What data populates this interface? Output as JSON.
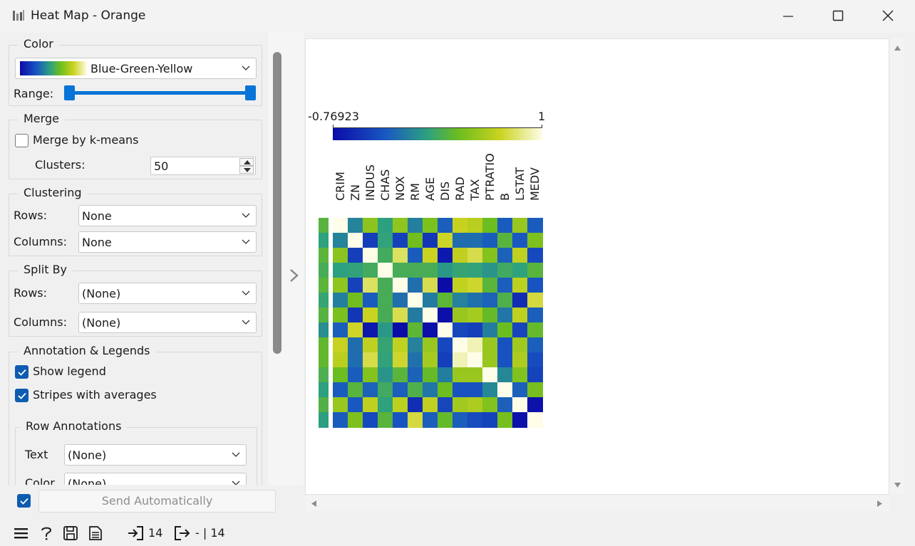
{
  "window": {
    "title": "Heat Map - Orange"
  },
  "color": {
    "group_title": "Color",
    "palette_name": "Blue-Green-Yellow",
    "range_label": "Range:"
  },
  "merge": {
    "group_title": "Merge",
    "merge_kmeans_label": "Merge by k-means",
    "merge_kmeans_checked": false,
    "clusters_label": "Clusters:",
    "clusters_value": "50"
  },
  "clustering": {
    "group_title": "Clustering",
    "rows_label": "Rows:",
    "rows_value": "None",
    "columns_label": "Columns:",
    "columns_value": "None"
  },
  "split_by": {
    "group_title": "Split By",
    "rows_label": "Rows:",
    "rows_value": "(None)",
    "columns_label": "Columns:",
    "columns_value": "(None)"
  },
  "annotation": {
    "group_title": "Annotation & Legends",
    "show_legend_label": "Show legend",
    "show_legend_checked": true,
    "stripes_label": "Stripes with averages",
    "stripes_checked": true,
    "row_annotations": {
      "group_title": "Row Annotations",
      "text_label": "Text",
      "text_value": "(None)",
      "color_label": "Color",
      "color_value": "(None)"
    }
  },
  "send": {
    "auto_checked": true,
    "label": "Send Automatically"
  },
  "status": {
    "input_count": "14",
    "output_text": "- | 14"
  },
  "heatmap": {
    "legend_min": "-0.76923",
    "legend_max": "1",
    "columns": [
      "CRIM",
      "ZN",
      "INDUS",
      "CHAS",
      "NOX",
      "RM",
      "AGE",
      "DIS",
      "RAD",
      "TAX",
      "PTRATIO",
      "B",
      "LSTAT",
      "MEDV"
    ],
    "palette": [
      "#0b0ba8",
      "#1957c2",
      "#2da080",
      "#6cbd1e",
      "#cbd320",
      "#fefde8"
    ],
    "colormap_min": -0.76923,
    "colormap_max": 1,
    "matrix": [
      [
        1.0,
        -0.2,
        0.41,
        -0.06,
        0.42,
        -0.22,
        0.35,
        -0.38,
        0.63,
        0.58,
        0.29,
        -0.39,
        0.46,
        -0.39
      ],
      [
        -0.2,
        1.0,
        -0.53,
        -0.04,
        -0.52,
        0.31,
        -0.57,
        0.66,
        -0.31,
        -0.31,
        -0.39,
        0.18,
        -0.41,
        0.36
      ],
      [
        0.41,
        -0.53,
        1.0,
        0.06,
        0.76,
        -0.39,
        0.64,
        -0.71,
        0.6,
        0.72,
        0.38,
        -0.36,
        0.6,
        -0.48
      ],
      [
        -0.06,
        -0.04,
        0.06,
        1.0,
        0.09,
        0.09,
        0.09,
        -0.1,
        -0.01,
        -0.04,
        -0.12,
        0.05,
        -0.05,
        0.18
      ],
      [
        0.42,
        -0.52,
        0.76,
        0.09,
        1.0,
        -0.3,
        0.73,
        -0.77,
        0.61,
        0.67,
        0.19,
        -0.38,
        0.59,
        -0.43
      ],
      [
        -0.22,
        0.31,
        -0.39,
        0.09,
        -0.3,
        1.0,
        -0.24,
        0.21,
        -0.21,
        -0.29,
        -0.36,
        0.13,
        -0.61,
        0.7
      ],
      [
        0.35,
        -0.57,
        0.64,
        0.09,
        0.73,
        -0.24,
        1.0,
        -0.75,
        0.46,
        0.51,
        0.26,
        -0.27,
        0.6,
        -0.38
      ],
      [
        -0.38,
        0.66,
        -0.71,
        -0.1,
        -0.77,
        0.21,
        -0.75,
        1.0,
        -0.49,
        -0.53,
        -0.23,
        0.29,
        -0.5,
        0.25
      ],
      [
        0.63,
        -0.31,
        0.6,
        -0.01,
        0.61,
        -0.21,
        0.46,
        -0.49,
        1.0,
        0.91,
        0.46,
        -0.44,
        0.49,
        -0.38
      ],
      [
        0.58,
        -0.31,
        0.72,
        -0.04,
        0.67,
        -0.29,
        0.51,
        -0.53,
        0.91,
        1.0,
        0.46,
        -0.44,
        0.54,
        -0.47
      ],
      [
        0.29,
        -0.39,
        0.38,
        -0.12,
        0.19,
        -0.36,
        0.26,
        -0.23,
        0.46,
        0.46,
        1.0,
        -0.18,
        0.37,
        -0.51
      ],
      [
        -0.39,
        0.18,
        -0.36,
        0.05,
        -0.38,
        0.13,
        -0.27,
        0.29,
        -0.44,
        -0.44,
        -0.18,
        1.0,
        -0.37,
        0.33
      ],
      [
        0.46,
        -0.41,
        0.6,
        -0.05,
        0.59,
        -0.61,
        0.6,
        -0.5,
        0.49,
        0.54,
        0.37,
        -0.37,
        1.0,
        -0.74
      ],
      [
        -0.39,
        0.36,
        -0.48,
        0.18,
        -0.43,
        0.7,
        -0.38,
        0.25,
        -0.38,
        -0.47,
        -0.51,
        0.33,
        -0.74,
        1.0
      ]
    ]
  }
}
